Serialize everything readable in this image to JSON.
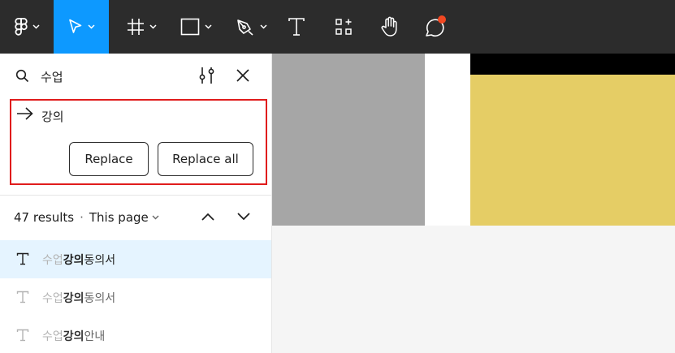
{
  "toolbar": {
    "tools": [
      "main-menu",
      "move",
      "frame",
      "shape",
      "pen",
      "text",
      "resources",
      "hand",
      "comments"
    ],
    "active_tool": "move",
    "accent_color": "#0d99ff",
    "notification_color": "#f24822"
  },
  "find": {
    "query": "수업",
    "replace_value": "강의",
    "replace_label": "Replace",
    "replace_all_label": "Replace all"
  },
  "results": {
    "count_label": "47 results",
    "separator": "·",
    "scope_label": "This page"
  },
  "items": [
    {
      "pre": "수업",
      "match": "강의",
      "post": "동의서",
      "selected": true
    },
    {
      "pre": "수업",
      "match": "강의",
      "post": "동의서",
      "selected": false
    },
    {
      "pre": "수업",
      "match": "강의",
      "post": "안내",
      "selected": false
    }
  ],
  "colors": {
    "highlight_border": "#e01c1c",
    "selected_row": "#e5f4ff",
    "canvas_yellow": "#e5cd65",
    "canvas_gray": "#a6a6a6"
  }
}
